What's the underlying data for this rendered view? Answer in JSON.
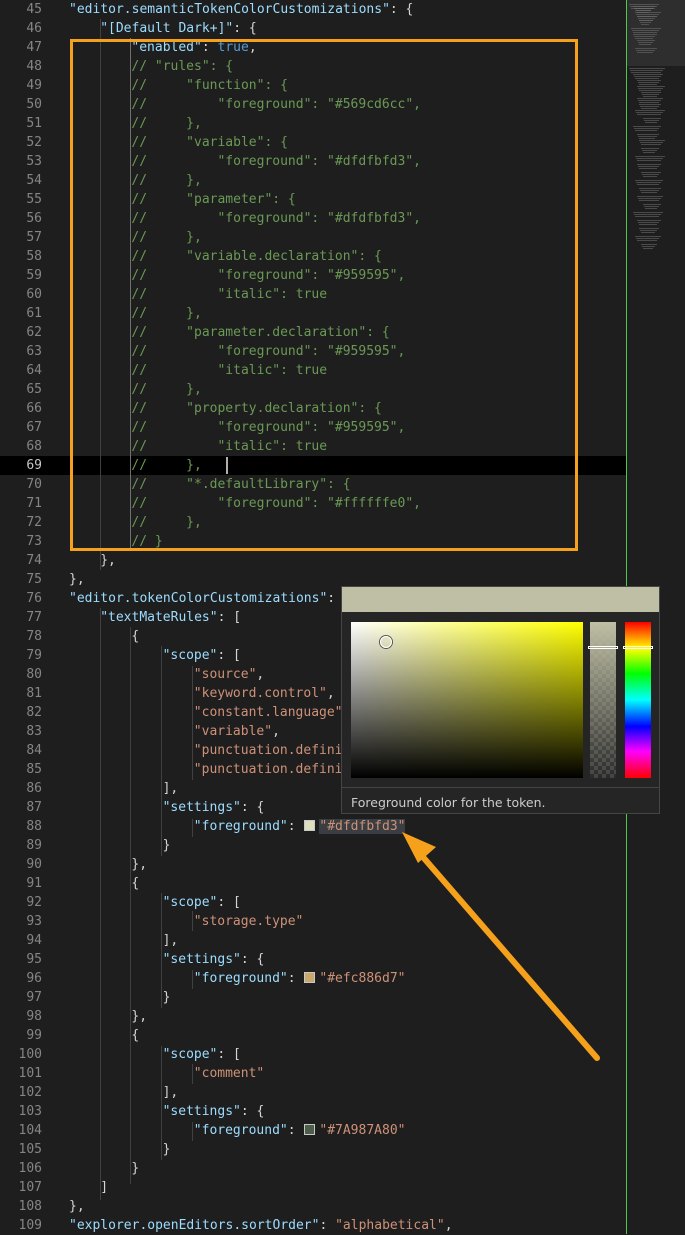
{
  "colors": {
    "annotation": "#f5a11c",
    "key": "#9cdcfe",
    "string": "#ce9178",
    "comment": "#6a9955",
    "keyword": "#569cd6",
    "line_number": "#858585",
    "minimap_border": "#4ec94e"
  },
  "editor": {
    "lines": [
      {
        "n": "45",
        "ind": 1,
        "t": [
          [
            "k",
            "\"editor.semanticTokenColorCustomizations\""
          ],
          [
            "p",
            ": {"
          ]
        ]
      },
      {
        "n": "46",
        "ind": 2,
        "t": [
          [
            "k",
            "\"[Default Dark+]\""
          ],
          [
            "p",
            ": {"
          ]
        ]
      },
      {
        "n": "47",
        "ind": 3,
        "t": [
          [
            "k",
            "\"enabled\""
          ],
          [
            "p",
            ": "
          ],
          [
            "v",
            "true"
          ],
          [
            "p",
            ","
          ]
        ]
      },
      {
        "n": "48",
        "ind": 3,
        "t": [
          [
            "c",
            "// \"rules\": {"
          ]
        ]
      },
      {
        "n": "49",
        "ind": 3,
        "t": [
          [
            "c",
            "//     \"function\": {"
          ]
        ]
      },
      {
        "n": "50",
        "ind": 3,
        "t": [
          [
            "c",
            "//         \"foreground\": \"#569cd6cc\","
          ]
        ]
      },
      {
        "n": "51",
        "ind": 3,
        "t": [
          [
            "c",
            "//     },"
          ]
        ]
      },
      {
        "n": "52",
        "ind": 3,
        "t": [
          [
            "c",
            "//     \"variable\": {"
          ]
        ]
      },
      {
        "n": "53",
        "ind": 3,
        "t": [
          [
            "c",
            "//         \"foreground\": \"#dfdfbfd3\","
          ]
        ]
      },
      {
        "n": "54",
        "ind": 3,
        "t": [
          [
            "c",
            "//     },"
          ]
        ]
      },
      {
        "n": "55",
        "ind": 3,
        "t": [
          [
            "c",
            "//     \"parameter\": {"
          ]
        ]
      },
      {
        "n": "56",
        "ind": 3,
        "t": [
          [
            "c",
            "//         \"foreground\": \"#dfdfbfd3\","
          ]
        ]
      },
      {
        "n": "57",
        "ind": 3,
        "t": [
          [
            "c",
            "//     },"
          ]
        ]
      },
      {
        "n": "58",
        "ind": 3,
        "t": [
          [
            "c",
            "//     \"variable.declaration\": {"
          ]
        ]
      },
      {
        "n": "59",
        "ind": 3,
        "t": [
          [
            "c",
            "//         \"foreground\": \"#959595\","
          ]
        ]
      },
      {
        "n": "60",
        "ind": 3,
        "t": [
          [
            "c",
            "//         \"italic\": true"
          ]
        ]
      },
      {
        "n": "61",
        "ind": 3,
        "t": [
          [
            "c",
            "//     },"
          ]
        ]
      },
      {
        "n": "62",
        "ind": 3,
        "t": [
          [
            "c",
            "//     \"parameter.declaration\": {"
          ]
        ]
      },
      {
        "n": "63",
        "ind": 3,
        "t": [
          [
            "c",
            "//         \"foreground\": \"#959595\","
          ]
        ]
      },
      {
        "n": "64",
        "ind": 3,
        "t": [
          [
            "c",
            "//         \"italic\": true"
          ]
        ]
      },
      {
        "n": "65",
        "ind": 3,
        "t": [
          [
            "c",
            "//     },"
          ]
        ]
      },
      {
        "n": "66",
        "ind": 3,
        "t": [
          [
            "c",
            "//     \"property.declaration\": {"
          ]
        ]
      },
      {
        "n": "67",
        "ind": 3,
        "t": [
          [
            "c",
            "//         \"foreground\": \"#959595\","
          ]
        ]
      },
      {
        "n": "68",
        "ind": 3,
        "t": [
          [
            "c",
            "//         \"italic\": true"
          ]
        ]
      },
      {
        "n": "69",
        "ind": 3,
        "t": [
          [
            "c",
            "//     },"
          ]
        ],
        "current": true
      },
      {
        "n": "70",
        "ind": 3,
        "t": [
          [
            "c",
            "//     \"*.defaultLibrary\": {"
          ]
        ]
      },
      {
        "n": "71",
        "ind": 3,
        "t": [
          [
            "c",
            "//         \"foreground\": \"#ffffffe0\","
          ]
        ]
      },
      {
        "n": "72",
        "ind": 3,
        "t": [
          [
            "c",
            "//     },"
          ]
        ]
      },
      {
        "n": "73",
        "ind": 3,
        "t": [
          [
            "c",
            "// }"
          ]
        ]
      },
      {
        "n": "74",
        "ind": 2,
        "t": [
          [
            "p",
            "},"
          ]
        ]
      },
      {
        "n": "75",
        "ind": 1,
        "t": [
          [
            "p",
            "},"
          ]
        ]
      },
      {
        "n": "76",
        "ind": 1,
        "t": [
          [
            "k",
            "\"editor.tokenColorCustomizations\""
          ],
          [
            "p",
            ": {"
          ]
        ]
      },
      {
        "n": "77",
        "ind": 2,
        "t": [
          [
            "k",
            "\"textMateRules\""
          ],
          [
            "p",
            ": ["
          ]
        ]
      },
      {
        "n": "78",
        "ind": 3,
        "t": [
          [
            "p",
            "{"
          ]
        ]
      },
      {
        "n": "79",
        "ind": 4,
        "t": [
          [
            "k",
            "\"scope\""
          ],
          [
            "p",
            ": ["
          ]
        ]
      },
      {
        "n": "80",
        "ind": 5,
        "t": [
          [
            "s",
            "\"source\""
          ],
          [
            "p",
            ","
          ]
        ]
      },
      {
        "n": "81",
        "ind": 5,
        "t": [
          [
            "s",
            "\"keyword.control\""
          ],
          [
            "p",
            ","
          ]
        ]
      },
      {
        "n": "82",
        "ind": 5,
        "t": [
          [
            "s",
            "\"constant.language\""
          ],
          [
            "p",
            ","
          ]
        ]
      },
      {
        "n": "83",
        "ind": 5,
        "t": [
          [
            "s",
            "\"variable\""
          ],
          [
            "p",
            ","
          ]
        ]
      },
      {
        "n": "84",
        "ind": 5,
        "t": [
          [
            "s",
            "\"punctuation.definition\""
          ],
          [
            "p",
            ","
          ]
        ]
      },
      {
        "n": "85",
        "ind": 5,
        "t": [
          [
            "s",
            "\"punctuation.definition\""
          ]
        ]
      },
      {
        "n": "86",
        "ind": 4,
        "t": [
          [
            "p",
            "],"
          ]
        ]
      },
      {
        "n": "87",
        "ind": 4,
        "t": [
          [
            "k",
            "\"settings\""
          ],
          [
            "p",
            ": {"
          ]
        ]
      },
      {
        "n": "88",
        "ind": 5,
        "t": [
          [
            "k",
            "\"foreground\""
          ],
          [
            "p",
            ": "
          ],
          [
            "sw",
            "#dfdfbf"
          ],
          [
            "sh",
            "\"#dfdfbfd3\""
          ]
        ]
      },
      {
        "n": "89",
        "ind": 4,
        "t": [
          [
            "p",
            "}"
          ]
        ]
      },
      {
        "n": "90",
        "ind": 3,
        "t": [
          [
            "p",
            "},"
          ]
        ]
      },
      {
        "n": "91",
        "ind": 3,
        "t": [
          [
            "p",
            "{"
          ]
        ]
      },
      {
        "n": "92",
        "ind": 4,
        "t": [
          [
            "k",
            "\"scope\""
          ],
          [
            "p",
            ": ["
          ]
        ]
      },
      {
        "n": "93",
        "ind": 5,
        "t": [
          [
            "s",
            "\"storage.type\""
          ]
        ]
      },
      {
        "n": "94",
        "ind": 4,
        "t": [
          [
            "p",
            "],"
          ]
        ]
      },
      {
        "n": "95",
        "ind": 4,
        "t": [
          [
            "k",
            "\"settings\""
          ],
          [
            "p",
            ": {"
          ]
        ]
      },
      {
        "n": "96",
        "ind": 5,
        "t": [
          [
            "k",
            "\"foreground\""
          ],
          [
            "p",
            ": "
          ],
          [
            "sw",
            "#c8a86d"
          ],
          [
            "s",
            "\"#efc886d7\""
          ]
        ]
      },
      {
        "n": "97",
        "ind": 4,
        "t": [
          [
            "p",
            "}"
          ]
        ]
      },
      {
        "n": "98",
        "ind": 3,
        "t": [
          [
            "p",
            "},"
          ]
        ]
      },
      {
        "n": "99",
        "ind": 3,
        "t": [
          [
            "p",
            "{"
          ]
        ]
      },
      {
        "n": "100",
        "ind": 4,
        "t": [
          [
            "k",
            "\"scope\""
          ],
          [
            "p",
            ": ["
          ]
        ]
      },
      {
        "n": "101",
        "ind": 5,
        "t": [
          [
            "s",
            "\"comment\""
          ]
        ]
      },
      {
        "n": "102",
        "ind": 4,
        "t": [
          [
            "p",
            "],"
          ]
        ]
      },
      {
        "n": "103",
        "ind": 4,
        "t": [
          [
            "k",
            "\"settings\""
          ],
          [
            "p",
            ": {"
          ]
        ]
      },
      {
        "n": "104",
        "ind": 5,
        "t": [
          [
            "k",
            "\"foreground\""
          ],
          [
            "p",
            ": "
          ],
          [
            "sw",
            "#4c5f4a"
          ],
          [
            "s",
            "\"#7A987A80\""
          ]
        ]
      },
      {
        "n": "105",
        "ind": 4,
        "t": [
          [
            "p",
            "}"
          ]
        ]
      },
      {
        "n": "106",
        "ind": 3,
        "t": [
          [
            "p",
            "}"
          ]
        ]
      },
      {
        "n": "107",
        "ind": 2,
        "t": [
          [
            "p",
            "]"
          ]
        ]
      },
      {
        "n": "108",
        "ind": 1,
        "t": [
          [
            "p",
            "},"
          ]
        ]
      },
      {
        "n": "109",
        "ind": 1,
        "t": [
          [
            "k",
            "\"explorer.openEditors.sortOrder\""
          ],
          [
            "p",
            ": "
          ],
          [
            "s",
            "\"alphabetical\""
          ],
          [
            "p",
            ","
          ]
        ]
      }
    ]
  },
  "color_picker": {
    "header_color": "#bfbfa5",
    "hue_color": "#ffff00",
    "hover_text": "Foreground color for the token."
  }
}
